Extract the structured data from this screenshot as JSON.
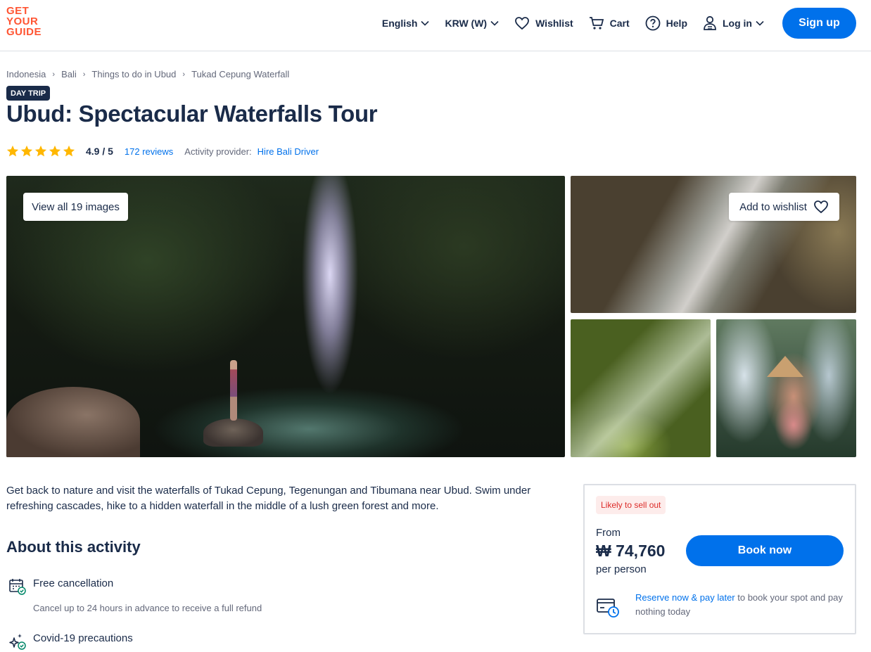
{
  "header": {
    "logo_lines": [
      "GET",
      "YOUR",
      "GUIDE"
    ],
    "language": "English",
    "currency": "KRW (W)",
    "wishlist": "Wishlist",
    "cart": "Cart",
    "help": "Help",
    "login": "Log in",
    "signup": "Sign up"
  },
  "breadcrumb": [
    "Indonesia",
    "Bali",
    "Things to do in Ubud",
    "Tukad Cepung Waterfall"
  ],
  "badge": "DAY TRIP",
  "title": "Ubud: Spectacular Waterfalls Tour",
  "rating": {
    "stars": 5,
    "value": "4.9 / 5",
    "reviews": "172 reviews",
    "provider_label": "Activity provider:",
    "provider": "Hire Bali Driver"
  },
  "gallery": {
    "view_all": "View all 19 images",
    "add_wishlist": "Add to wishlist"
  },
  "description": "Get back to nature and visit the waterfalls of Tukad Cepung, Tegenungan and Tibumana near Ubud. Swim under refreshing cascades, hike to a hidden waterfall in the middle of a lush green forest and more.",
  "about": {
    "title": "About this activity",
    "features": [
      {
        "title": "Free cancellation",
        "sub": "Cancel up to 24 hours in advance to receive a full refund"
      },
      {
        "title": "Covid-19 precautions",
        "sub": ""
      }
    ]
  },
  "booking": {
    "sellout": "Likely to sell out",
    "from": "From",
    "price": "₩ 74,760",
    "per": "per person",
    "book": "Book now",
    "reserve_link": "Reserve now & pay later",
    "reserve_rest": " to book your spot and pay nothing today"
  },
  "colors": {
    "brand": "#ff5533",
    "primary": "#0071eb",
    "text": "#1a2b49",
    "star": "#ffb700",
    "sellout": "#dc2c29"
  }
}
